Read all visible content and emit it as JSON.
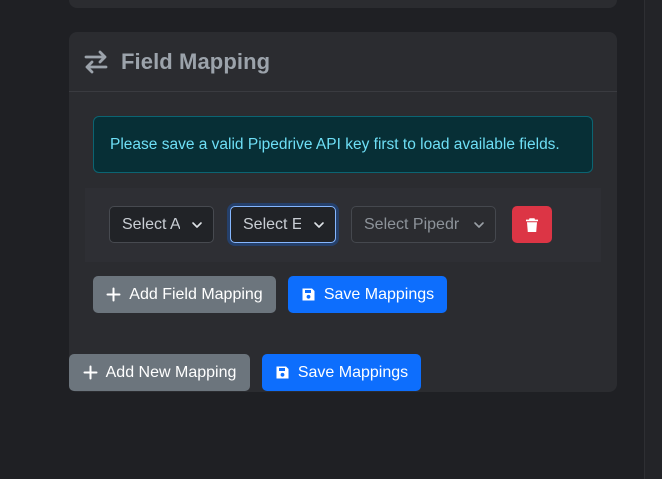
{
  "field_mapping": {
    "title": "Field Mapping",
    "header_icon": "arrows-exchange-icon",
    "alert_text": "Please save a valid Pipedrive API key first to load available fields.",
    "row": {
      "select_1": "Select A",
      "select_2": "Select E",
      "select_3": "Select Pipedr",
      "delete_icon": "trash-icon"
    },
    "add_field_label": "Add Field Mapping",
    "save_label": "Save Mappings"
  },
  "footer": {
    "add_new_label": "Add New Mapping",
    "save_label": "Save Mappings"
  },
  "colors": {
    "background": "#1f2024",
    "card": "#2b2c30",
    "alert_text": "#6edff6",
    "danger": "#dc3545",
    "primary": "#0d6efd",
    "secondary": "#6c757d"
  }
}
